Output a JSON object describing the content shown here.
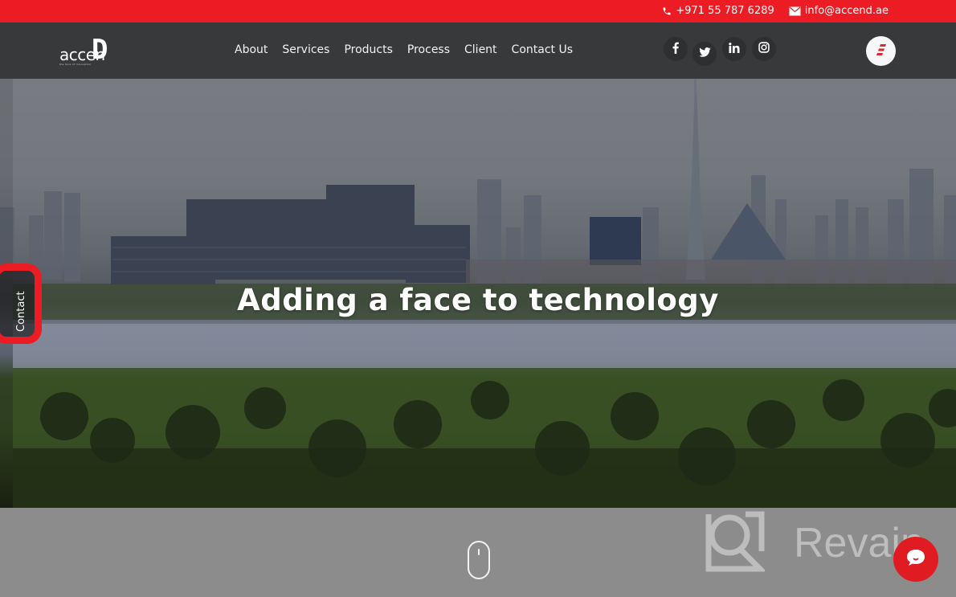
{
  "topbar": {
    "phone_icon": "phone-icon",
    "phone": "+971 55 787 6289",
    "email_icon": "envelope-icon",
    "email": "info@accend.ae"
  },
  "header": {
    "logo": {
      "word": "accen",
      "letter": "D",
      "tagline": "the face of innovation"
    },
    "nav": [
      {
        "label": "About"
      },
      {
        "label": "Services"
      },
      {
        "label": "Products"
      },
      {
        "label": "Process"
      },
      {
        "label": "Client"
      },
      {
        "label": "Contact Us"
      }
    ],
    "social": [
      {
        "icon": "facebook-icon",
        "glyph": "f"
      },
      {
        "icon": "twitter-icon",
        "glyph": "t"
      },
      {
        "icon": "linkedin-icon",
        "glyph": "in"
      },
      {
        "icon": "instagram-icon",
        "glyph": "ig"
      }
    ],
    "menu_icon": "hamburger-menu-icon"
  },
  "hero": {
    "title": "Adding a face to technology"
  },
  "side_tab": {
    "label": "Contact"
  },
  "scroll_hint": {
    "icon": "mouse-scroll-icon"
  },
  "watermark": {
    "text": "Revain"
  },
  "chat": {
    "icon": "chat-bubble-icon"
  },
  "colors": {
    "brand_red": "#ec1c24",
    "header_bg": "#38393b",
    "bottom_bg": "#8c8c8c"
  }
}
